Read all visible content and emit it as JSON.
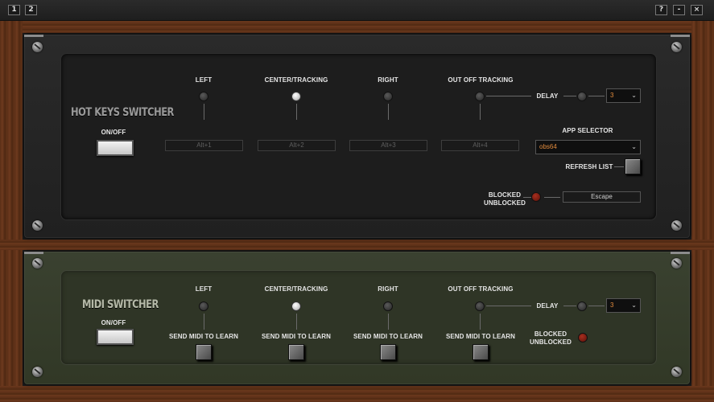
{
  "window": {
    "tab1": "1",
    "tab2": "2",
    "help": "?",
    "minimize": "-",
    "close": "×"
  },
  "hotkeys": {
    "title": "HOT KEYS SWITCHER",
    "onoff_label": "ON/OFF",
    "positions": [
      {
        "label": "LEFT",
        "hotkey": "Alt+1",
        "active": false
      },
      {
        "label": "CENTER/TRACKING",
        "hotkey": "Alt+2",
        "active": true
      },
      {
        "label": "RIGHT",
        "hotkey": "Alt+3",
        "active": false
      },
      {
        "label": "OUT OFF TRACKING",
        "hotkey": "Alt+4",
        "active": false
      }
    ],
    "delay_label": "DELAY",
    "delay_value": "3",
    "app_selector_label": "APP SELECTOR",
    "app_selected": "obs64",
    "refresh_label": "REFRESH LIST",
    "blocked_label": "BLOCKED",
    "unblocked_label": "UNBLOCKED",
    "block_key": "Escape"
  },
  "midi": {
    "title": "MIDI SWITCHER",
    "onoff_label": "ON/OFF",
    "positions": [
      {
        "label": "LEFT",
        "learn": "SEND MIDI TO LEARN",
        "active": false
      },
      {
        "label": "CENTER/TRACKING",
        "learn": "SEND MIDI TO LEARN",
        "active": true
      },
      {
        "label": "RIGHT",
        "learn": "SEND MIDI TO LEARN",
        "active": false
      },
      {
        "label": "OUT OFF TRACKING",
        "learn": "SEND MIDI TO LEARN",
        "active": false
      }
    ],
    "delay_label": "DELAY",
    "delay_value": "3",
    "blocked_label": "BLOCKED",
    "unblocked_label": "UNBLOCKED"
  },
  "colors": {
    "accent_text": "#e08a3c",
    "led_active": "#ffffff",
    "led_blocked": "#a82e1e",
    "wood": "#5a2e17",
    "midi_panel": "#3a4130"
  }
}
